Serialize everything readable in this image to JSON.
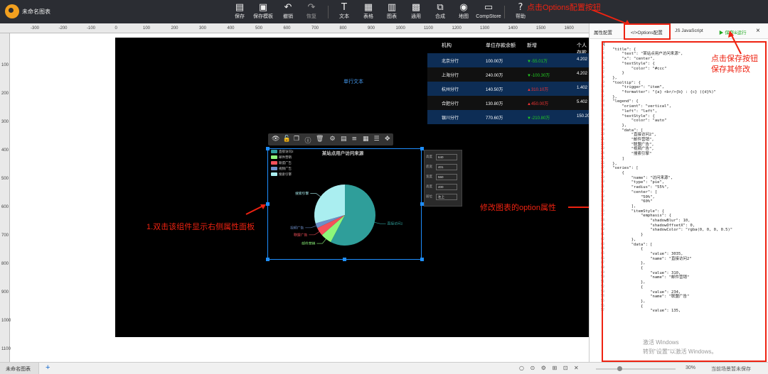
{
  "app": {
    "title": "未命名图表"
  },
  "toolbar": [
    {
      "icon": "save-icon",
      "label": "保存"
    },
    {
      "icon": "save-template-icon",
      "label": "保存模板"
    },
    {
      "icon": "undo-icon",
      "label": "撤销"
    },
    {
      "icon": "redo-icon",
      "label": "恢复"
    },
    {
      "icon": "text-icon",
      "label": "文本"
    },
    {
      "icon": "table-icon",
      "label": "表格"
    },
    {
      "icon": "chart-icon",
      "label": "图表"
    },
    {
      "icon": "general-icon",
      "label": "通用"
    },
    {
      "icon": "composite-icon",
      "label": "合成"
    },
    {
      "icon": "map-icon",
      "label": "地图"
    },
    {
      "icon": "compstore-icon",
      "label": "CompStore"
    },
    {
      "icon": "help-icon",
      "label": "帮助"
    }
  ],
  "ruler": {
    "top": [
      "-300",
      "-200",
      "-100",
      "0",
      "100",
      "200",
      "300",
      "400",
      "500",
      "600",
      "700",
      "800",
      "900",
      "1000",
      "1100",
      "1200",
      "1300",
      "1400",
      "1500",
      "1600"
    ],
    "left": [
      "100",
      "200",
      "300",
      "400",
      "500",
      "600",
      "700",
      "800",
      "900",
      "1000",
      "1100"
    ]
  },
  "canvas": {
    "text_component": "单行文本"
  },
  "table": {
    "headers": [
      "机构",
      "单位存款余额",
      "新增",
      "个人存款"
    ],
    "rows": [
      {
        "org": "北京分行",
        "balance": "100.00万",
        "change": "▼-55.01万",
        "personal": "4.202",
        "dir": "down"
      },
      {
        "org": "上海分行",
        "balance": "240.00万",
        "change": "▼-100.30万",
        "personal": "4.202",
        "dir": "down"
      },
      {
        "org": "杭州分行",
        "balance": "140.50万",
        "change": "▲310.10万",
        "personal": "1.402",
        "dir": "up"
      },
      {
        "org": "合肥分行",
        "balance": "130.80万",
        "change": "▲450.00万",
        "personal": "5.402",
        "dir": "up"
      },
      {
        "org": "银川分行",
        "balance": "770.60万",
        "change": "▼-210.80万",
        "personal": "150.20",
        "dir": "down"
      }
    ]
  },
  "component_bar": [
    "eye-icon",
    "unlock-icon",
    "copy-icon",
    "info-icon",
    "delete-icon",
    "settings-icon",
    "save-icon",
    "sliders-icon",
    "palette-icon",
    "layers-icon",
    "move-icon"
  ],
  "float_panel": [
    {
      "label": "高度",
      "value": "640"
    },
    {
      "label": "底宽",
      "value": "401"
    },
    {
      "label": "宽度",
      "value": "560"
    },
    {
      "label": "高度",
      "value": "400"
    },
    {
      "label": "居位",
      "value": "左上"
    }
  ],
  "chart_data": {
    "type": "pie",
    "title": "某站点用户访问来源",
    "series": [
      {
        "name": "访问来源",
        "values": [
          3035,
          310,
          234,
          135,
          1548
        ]
      }
    ],
    "categories": [
      "直接访问2",
      "邮件营销",
      "联盟广告",
      "视频广告",
      "搜索引擎"
    ],
    "colors": [
      "#2f9e9a",
      "#8df77a",
      "#f5505a",
      "#6e8fc9",
      "#aaeef0"
    ],
    "legend": "top-left",
    "center": [
      "50%",
      "60%"
    ],
    "radius": "55%"
  },
  "annotations": {
    "a1": "1.双击该组件显示右侧属性面板",
    "a2": "点击Options配置按钮",
    "a3": "修改图表的option属性",
    "a4": "点击保存按钮保存其修改"
  },
  "panel": {
    "tabs": [
      "属性配置",
      "</>Options配置",
      "JS JavaScript",
      "▶ 保存&运行"
    ],
    "close": "×",
    "code": [
      "{",
      "    \"title\": {",
      "        \"text\": \"某站点用户访问来源\",",
      "        \"x\": \"center\",",
      "        \"textStyle\": {",
      "            \"color\": \"#ccc\"",
      "        }",
      "    },",
      "    \"tooltip\": {",
      "        \"trigger\": \"item\",",
      "        \"formatter\": \"{a} <br/>{b} : {c} ({d}%)\"",
      "    },",
      "    \"legend\": {",
      "        \"orient\": \"vertical\",",
      "        \"left\": \"left\",",
      "        \"textStyle\": {",
      "            \"color\": \"auto\"",
      "        },",
      "        \"data\": [",
      "            \"直接访问2\",",
      "            \"邮件营销\",",
      "            \"联盟广告\",",
      "            \"视频广告\",",
      "            \"搜索引擎\"",
      "        ]",
      "    },",
      "    \"series\": [",
      "        {",
      "            \"name\": \"访问来源\",",
      "            \"type\": \"pie\",",
      "            \"radius\": \"55%\",",
      "            \"center\": [",
      "                \"50%\",",
      "                \"60%\"",
      "            ],",
      "            \"itemStyle\": {",
      "                \"emphasis\": {",
      "                    \"shadowBlur\": 10,",
      "                    \"shadowOffsetX\": 0,",
      "                    \"shadowColor\": \"rgba(0, 0, 0, 0.5)\"",
      "                }",
      "            },",
      "            \"data\": [",
      "                {",
      "                    \"value\": 3035,",
      "                    \"name\": \"直接访问2\"",
      "                },",
      "                {",
      "                    \"value\": 310,",
      "                    \"name\": \"邮件营销\"",
      "                },",
      "                {",
      "                    \"value\": 234,",
      "                    \"name\": \"联盟广告\"",
      "                },",
      "                {",
      "                    \"value\": 135,"
    ]
  },
  "watermark": [
    "激活 Windows",
    "转到\"设置\"以激活 Windows。"
  ],
  "bottom": {
    "tab": "未命名图表",
    "plus": "+",
    "zoom": "30%",
    "status": "当前场景暂未保存",
    "icons": "○ ⊙ ⚙ ⊞ ⊡ ✕"
  }
}
